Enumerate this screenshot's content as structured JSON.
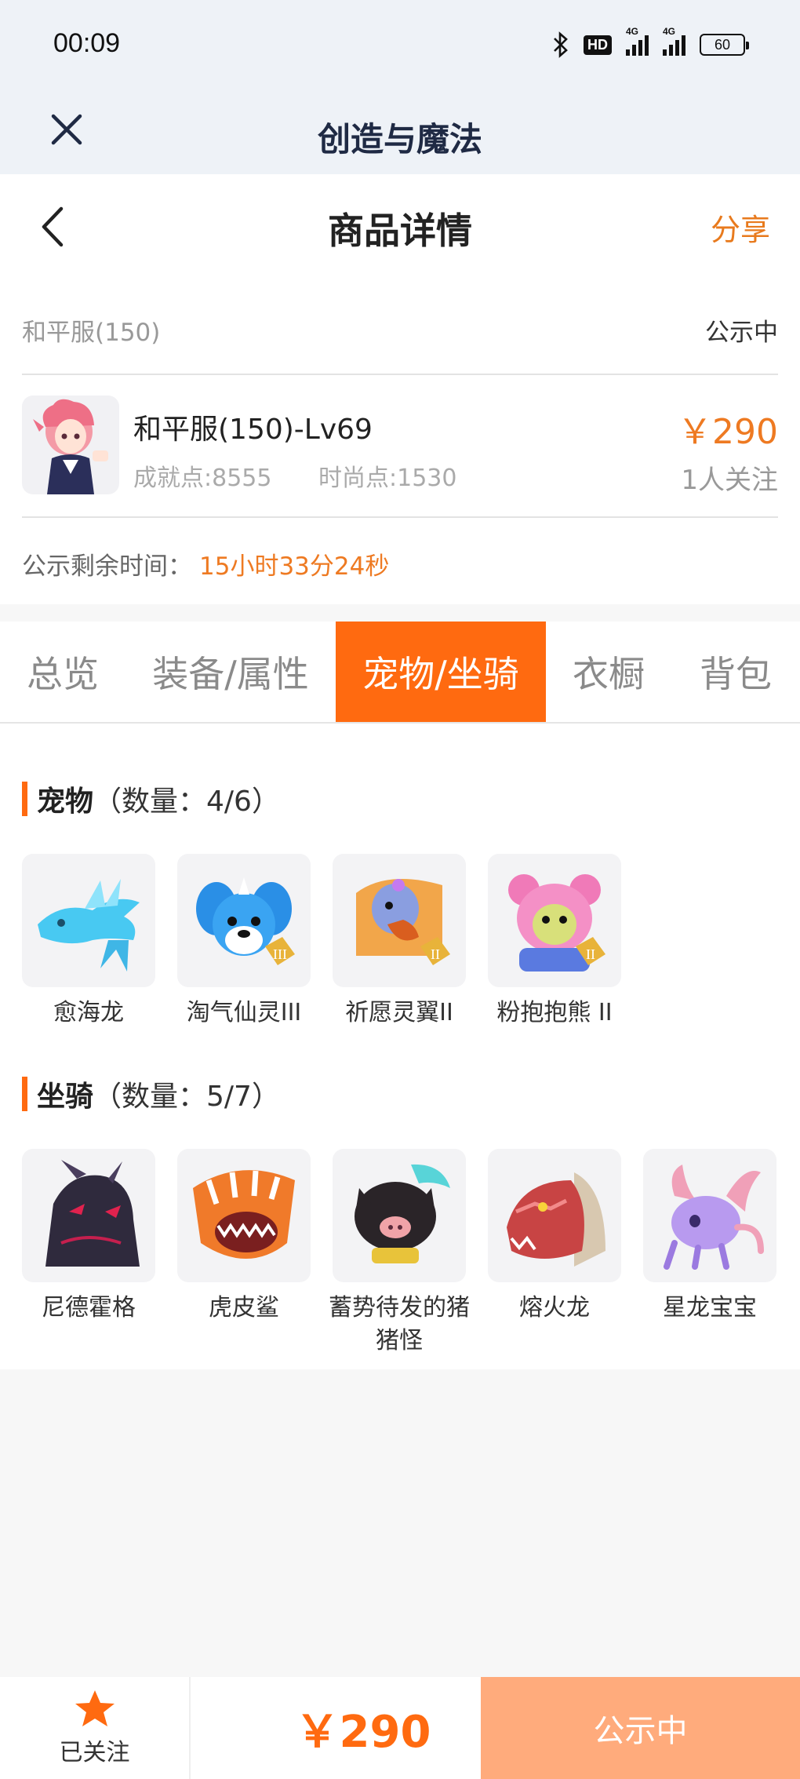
{
  "status_bar": {
    "time": "00:09",
    "hd_badge": "HD",
    "signal_tag_1": "4G",
    "signal_tag_2": "4G",
    "battery": "60"
  },
  "app_bar": {
    "title": "创造与魔法",
    "close_icon": "close-icon"
  },
  "nav": {
    "title": "商品详情",
    "share": "分享",
    "back_icon": "chevron-left-icon"
  },
  "listing": {
    "server": "和平服(150)",
    "status": "公示中",
    "name": "和平服(150)-Lv69",
    "achievement": "成就点:8555",
    "fashion": "时尚点:1530",
    "price": "￥290",
    "followers": "1人关注",
    "timer_label": "公示剩余时间：",
    "timer_value": "15小时33分24秒"
  },
  "tabs": [
    {
      "label": "总览",
      "active": false
    },
    {
      "label": "装备/属性",
      "active": false
    },
    {
      "label": "宠物/坐骑",
      "active": true
    },
    {
      "label": "衣橱",
      "active": false
    },
    {
      "label": "背包",
      "active": false
    }
  ],
  "pets": {
    "heading": "宠物",
    "count": "（数量：4/6）",
    "items": [
      {
        "name": "愈海龙",
        "icon": "sea-dragon-icon",
        "color": "#3fc7f0"
      },
      {
        "name": "淘气仙灵III",
        "icon": "blue-puppy-icon",
        "color": "#2a8fe6"
      },
      {
        "name": "祈愿灵翼II",
        "icon": "griffin-icon",
        "color": "#d9772a"
      },
      {
        "name": "粉抱抱熊 II",
        "icon": "pink-bear-icon",
        "color": "#f07ab8"
      }
    ]
  },
  "mounts": {
    "heading": "坐骑",
    "count": "（数量：5/7）",
    "items": [
      {
        "name": "尼德霍格",
        "icon": "dark-dragon-icon",
        "color": "#3a2f4a"
      },
      {
        "name": "虎皮鲨",
        "icon": "tiger-shark-icon",
        "color": "#f07a2a"
      },
      {
        "name": "蓄势待发的猪猪怪",
        "icon": "pig-monster-icon",
        "color": "#2a2428"
      },
      {
        "name": "熔火龙",
        "icon": "lava-dragon-icon",
        "color": "#c84444"
      },
      {
        "name": "星龙宝宝",
        "icon": "star-dragon-baby-icon",
        "color": "#b89aef"
      }
    ]
  },
  "bottom_bar": {
    "follow_label": "已关注",
    "star_icon": "star-icon",
    "price": "￥290",
    "status": "公示中"
  },
  "colors": {
    "accent": "#ff6a10",
    "price": "#ee7a22",
    "header_bg": "#eef2f7",
    "status_button": "#ffab7c"
  }
}
